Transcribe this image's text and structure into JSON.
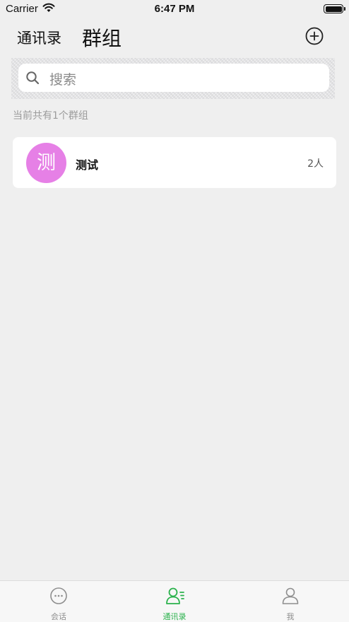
{
  "status_bar": {
    "carrier": "Carrier",
    "time": "6:47 PM"
  },
  "header": {
    "contacts_tab": "通讯录",
    "groups_tab": "群组",
    "add_icon": "plus-circle-icon"
  },
  "search": {
    "placeholder": "搜索",
    "icon": "search-icon"
  },
  "summary": {
    "count_text": "当前共有1个群组"
  },
  "groups": [
    {
      "avatar_char": "测",
      "avatar_color": "#e680e6",
      "name": "测试",
      "member_count": "2人"
    }
  ],
  "tab_bar": {
    "active_color": "#2bb24c",
    "inactive_color": "#8e8e8e",
    "items": [
      {
        "label": "会话",
        "icon": "chat-bubble-icon",
        "active": false
      },
      {
        "label": "通讯录",
        "icon": "contacts-icon",
        "active": true
      },
      {
        "label": "我",
        "icon": "person-icon",
        "active": false
      }
    ]
  }
}
